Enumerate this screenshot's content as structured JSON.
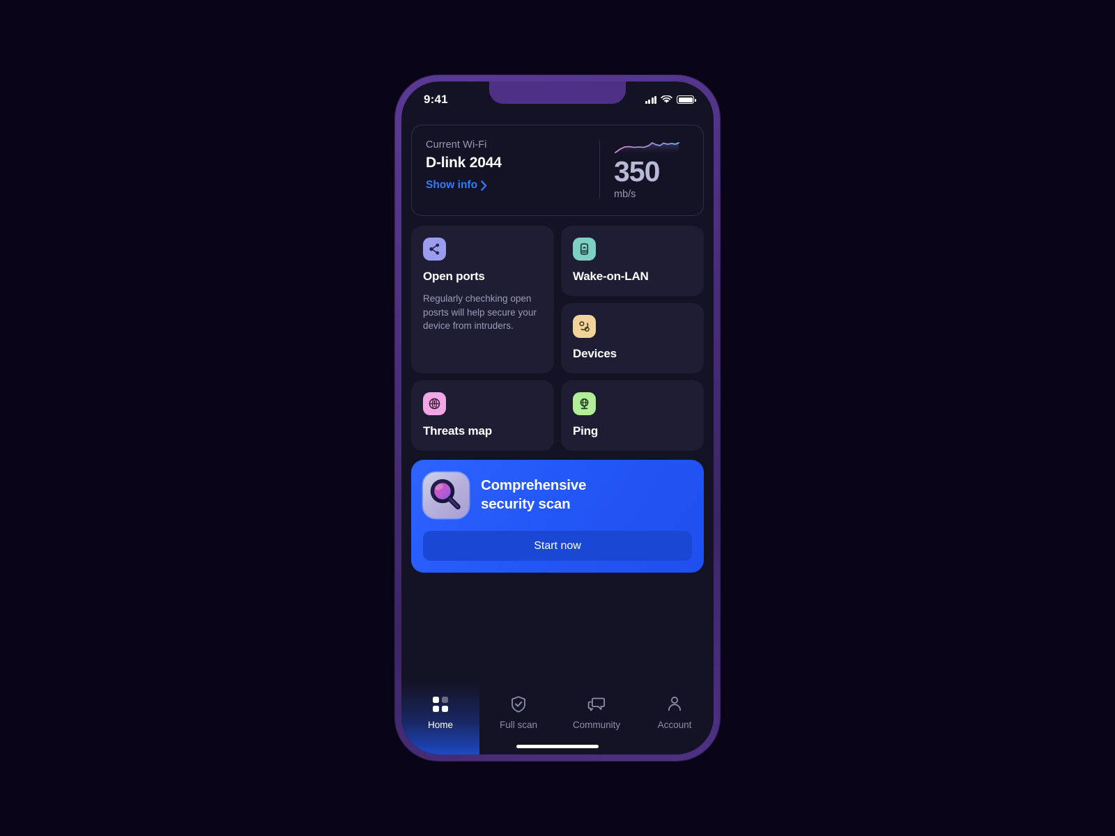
{
  "status_bar": {
    "time": "9:41",
    "signal_icon": "cellular-signal-icon",
    "wifi_icon": "wifi-icon",
    "battery_icon": "battery-full-icon"
  },
  "wifi_card": {
    "label": "Current Wi-Fi",
    "ssid": "D-link 2044",
    "link_label": "Show info",
    "link_color": "#2f7dfb",
    "chevron_icon": "chevron-right-icon",
    "speed_value": "350",
    "speed_unit": "mb/s",
    "sparkline_icon": "speed-sparkline"
  },
  "tiles": [
    {
      "id": "open-ports",
      "title": "Open ports",
      "description": "Regularly chechking open posrts will help secure your device from intruders.",
      "icon": "share-nodes-icon",
      "icon_bg": "#9a9cf0"
    },
    {
      "id": "wake-on-lan",
      "title": "Wake-on-LAN",
      "description": "",
      "icon": "device-server-icon",
      "icon_bg": "#7ecfc4"
    },
    {
      "id": "devices",
      "title": "Devices",
      "description": "",
      "icon": "linked-nodes-icon",
      "icon_bg": "#f0d49a"
    },
    {
      "id": "threats-map",
      "title": "Threats map",
      "description": "",
      "icon": "globe-alert-icon",
      "icon_bg": "#f3a6e6"
    },
    {
      "id": "ping",
      "title": "Ping",
      "description": "",
      "icon": "globe-stand-icon",
      "icon_bg": "#b2ee9a"
    }
  ],
  "promo": {
    "title_line1": "Comprehensive",
    "title_line2": "security scan",
    "button_label": "Start now",
    "icon": "magnifying-glass-3d-icon",
    "banner_color": "#2558f5",
    "button_color": "#1a47d4"
  },
  "bottom_nav": [
    {
      "id": "home",
      "label": "Home",
      "icon": "grid-dots-icon",
      "active": true
    },
    {
      "id": "full-scan",
      "label": "Full scan",
      "icon": "shield-check-icon",
      "active": false
    },
    {
      "id": "community",
      "label": "Community",
      "icon": "chat-bubbles-icon",
      "active": false
    },
    {
      "id": "account",
      "label": "Account",
      "icon": "user-icon",
      "active": false
    }
  ]
}
